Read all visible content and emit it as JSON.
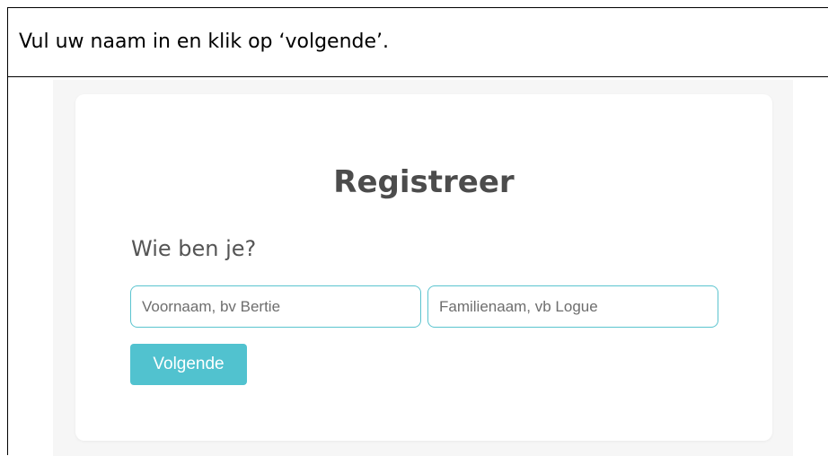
{
  "instruction": "Vul uw naam in en klik op ‘volgende’.",
  "form": {
    "title": "Registreer",
    "subtitle": "Wie ben je?",
    "first_name_placeholder": "Voornaam, bv Bertie",
    "last_name_placeholder": "Familienaam, vb Logue",
    "next_label": "Volgende"
  },
  "colors": {
    "accent": "#51c2cf",
    "card_background": "#ffffff",
    "frame_background": "#f6f6f6",
    "title_text": "#4c4c4c"
  }
}
